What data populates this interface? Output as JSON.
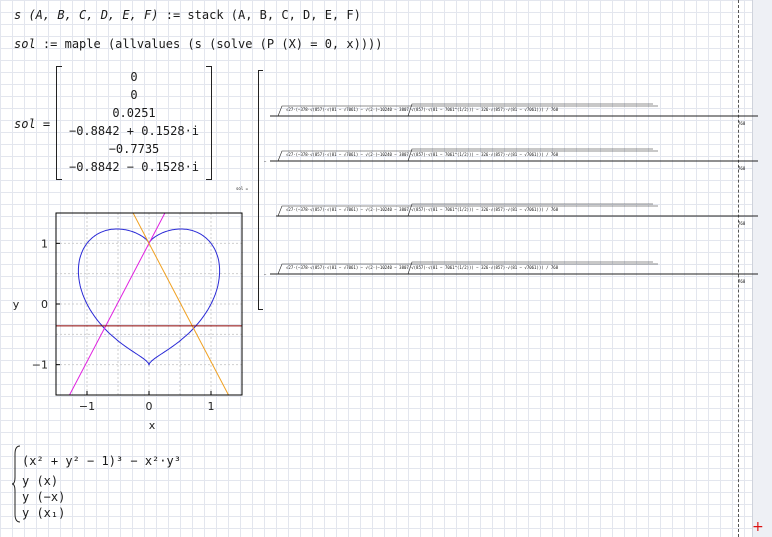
{
  "line1": {
    "lhs": "s (A, B, C, D, E, F)",
    "op": ":=",
    "rhs": "stack (A, B, C, D, E, F)"
  },
  "line2": {
    "lhs": "sol",
    "op": ":=",
    "rhs": "maple (allvalues (s (solve (P (X) = 0, x))))"
  },
  "result": {
    "label": "sol =",
    "rows": [
      "0",
      "0",
      "0.0251",
      "−0.8842 + 0.1528·i",
      "−0.7735",
      "−0.8842 − 0.1528·i"
    ]
  },
  "big_result": {
    "label": "sol =",
    "row_text": "√27·(−378·√(857)·√(81 − √7061) − √(2·(−10240 − 3807·√(857)·√(81 − 7061^(1/2))) − 326·√(857)·√(81 − √7061))) / 768",
    "tail": "768",
    "signs": [
      "",
      "−",
      "",
      "−"
    ]
  },
  "plot": {
    "xlabel": "x",
    "ylabel": "y",
    "x_ticks": [
      "−1",
      "0",
      "1"
    ],
    "y_ticks": [
      "1",
      "0",
      "−1"
    ],
    "colors": {
      "heart": "#2a2ad6",
      "line_pos": "#e020e0",
      "line_neg": "#f0a020",
      "horizontal": "#8b0000",
      "grid": "#cfcfcf"
    }
  },
  "chart_data": {
    "type": "line",
    "title": "",
    "xlabel": "x",
    "ylabel": "y",
    "xlim": [
      -1.5,
      1.5
    ],
    "ylim": [
      -1.5,
      1.5
    ],
    "grid": true,
    "series": [
      {
        "equation": "(x^2 + y^2 − 1)^3 − x^2·y^3 = 0"
      },
      {
        "equation": "y(x)"
      },
      {
        "equation": "y(−x)"
      },
      {
        "equation": "y(x1)",
        "y": -0.36
      }
    ]
  },
  "system": {
    "eq1": "(x² + y² − 1)³ − x²·y³",
    "eq2": "y (x)",
    "eq3": "y (−x)",
    "eq4": "y (x₁)"
  }
}
